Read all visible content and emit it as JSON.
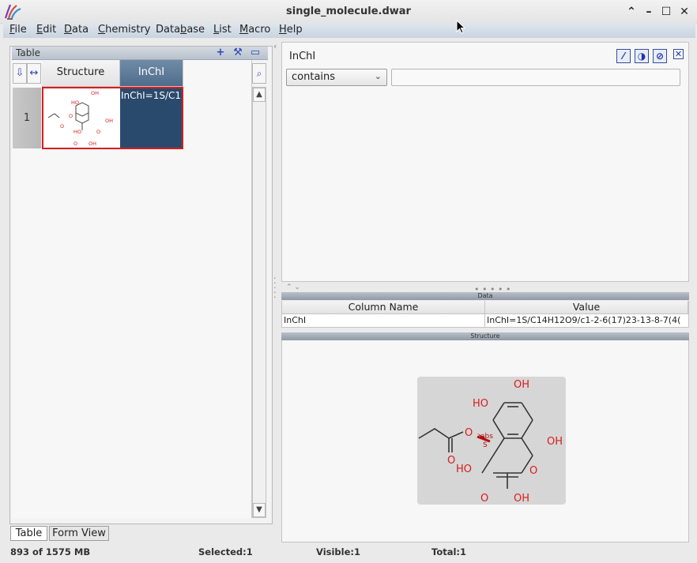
{
  "window": {
    "title": "single_molecule.dwar"
  },
  "menu": [
    {
      "label": "File",
      "key": "F",
      "rest": "ile"
    },
    {
      "label": "Edit",
      "key": "E",
      "rest": "dit"
    },
    {
      "label": "Data",
      "key": "D",
      "rest": "ata"
    },
    {
      "label": "Chemistry",
      "key": "C",
      "rest": "hemistry"
    },
    {
      "label": "Database",
      "pre": "Data",
      "key": "b",
      "rest": "ase"
    },
    {
      "label": "List",
      "key": "L",
      "rest": "ist"
    },
    {
      "label": "Macro",
      "key": "M",
      "rest": "acro"
    },
    {
      "label": "Help",
      "key": "H",
      "rest": "elp"
    }
  ],
  "table_panel": {
    "title": "Table",
    "columns": [
      "Structure",
      "InChI"
    ],
    "rows": [
      {
        "number": "1",
        "inchi_value": "InChI=1S/C1"
      }
    ]
  },
  "molecule_labels": {
    "oh": "OH",
    "ho": "HO",
    "o": "O",
    "abs": "abs",
    "s": "S"
  },
  "bottom_tabs": [
    "Table",
    "Form View"
  ],
  "filter": {
    "column": "InChI",
    "mode": "contains",
    "text": ""
  },
  "data_panel": {
    "title": "Data",
    "headers": [
      "Column Name",
      "Value"
    ],
    "row": {
      "name": "InChI",
      "value": "InChI=1S/C14H12O9/c1-2-6(17)23-13-8-7(4("
    }
  },
  "structure_panel": {
    "title": "Structure"
  },
  "status": {
    "memory": "893 of 1575 MB",
    "selected": "Selected:1",
    "visible": "Visible:1",
    "total": "Total:1"
  },
  "colors": {
    "accent": "#2c48b8",
    "selection": "#d81c1c",
    "active_header": "#4f6d8b",
    "atom_red": "#d81c1c"
  }
}
